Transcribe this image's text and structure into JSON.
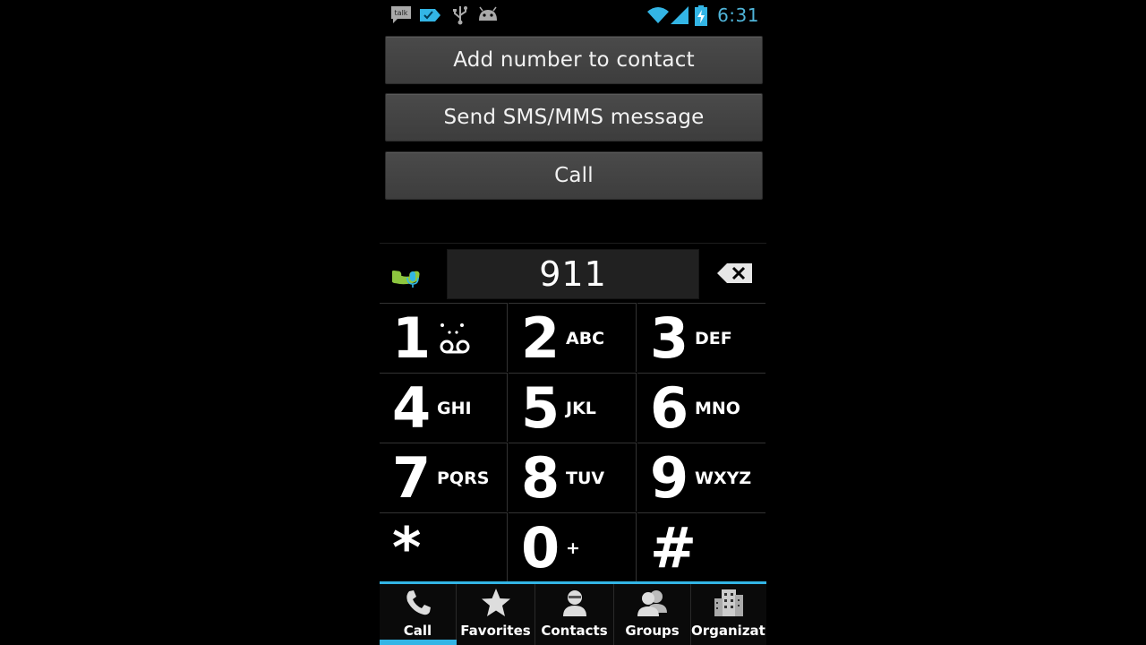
{
  "status_bar": {
    "time": "6:31",
    "talk_label": "talk",
    "icons": [
      "talk-icon",
      "tag-icon",
      "usb-icon",
      "android-debug-icon",
      "wifi-icon",
      "signal-icon",
      "battery-charging-icon"
    ]
  },
  "actions": {
    "add_contact": "Add number to contact",
    "send_sms": "Send SMS/MMS message",
    "call": "Call"
  },
  "dialer": {
    "number": "911",
    "keys": [
      {
        "num": "1",
        "letters": ""
      },
      {
        "num": "2",
        "letters": "ABC"
      },
      {
        "num": "3",
        "letters": "DEF"
      },
      {
        "num": "4",
        "letters": "GHI"
      },
      {
        "num": "5",
        "letters": "JKL"
      },
      {
        "num": "6",
        "letters": "MNO"
      },
      {
        "num": "7",
        "letters": "PQRS"
      },
      {
        "num": "8",
        "letters": "TUV"
      },
      {
        "num": "9",
        "letters": "WXYZ"
      },
      {
        "num": "*",
        "letters": ""
      },
      {
        "num": "0",
        "letters": "+"
      },
      {
        "num": "#",
        "letters": ""
      }
    ]
  },
  "tabs": [
    {
      "label": "Call",
      "icon": "phone-icon",
      "active": true
    },
    {
      "label": "Favorites",
      "icon": "star-icon",
      "active": false
    },
    {
      "label": "Contacts",
      "icon": "person-icon",
      "active": false
    },
    {
      "label": "Groups",
      "icon": "group-icon",
      "active": false
    },
    {
      "label": "Organizati",
      "icon": "building-icon",
      "active": false
    }
  ],
  "colors": {
    "accent": "#33b5e5",
    "call_green": "#8dc63f",
    "button_bg": "#444444"
  }
}
